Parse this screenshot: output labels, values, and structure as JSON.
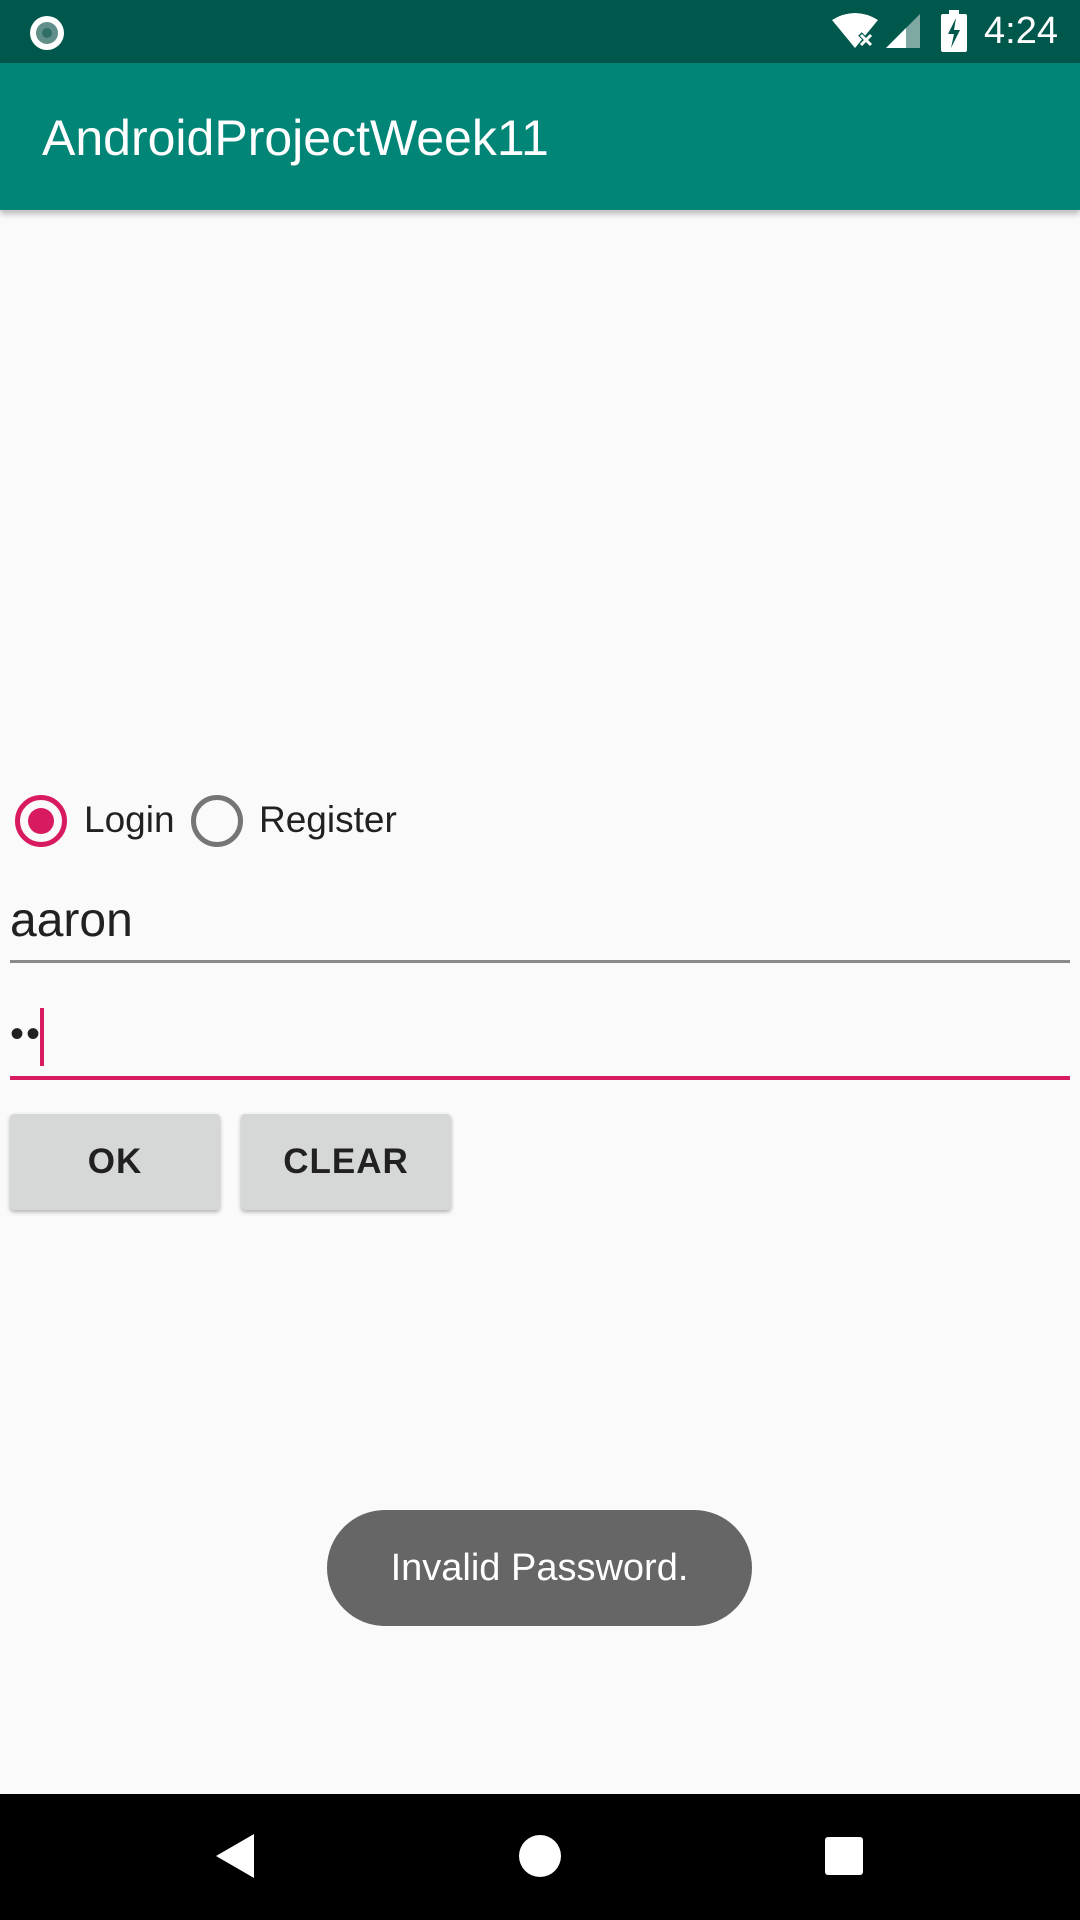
{
  "status_bar": {
    "time": "4:24",
    "icons": [
      "notification-dot-icon",
      "wifi-off-icon",
      "cell-signal-icon",
      "battery-charging-icon"
    ]
  },
  "app_bar": {
    "title": "AndroidProjectWeek11",
    "color": "#008577",
    "status_color": "#00574b"
  },
  "mode_selector": {
    "options": [
      {
        "label": "Login",
        "selected": true
      },
      {
        "label": "Register",
        "selected": false
      }
    ]
  },
  "form": {
    "username_value": "aaron",
    "password_value": "••"
  },
  "buttons": {
    "ok_label": "OK",
    "clear_label": "CLEAR"
  },
  "toast": {
    "message": "Invalid Password."
  },
  "nav_bar": {
    "icons": [
      "back-icon",
      "home-icon",
      "recents-icon"
    ]
  },
  "colors": {
    "accent": "#d81b60",
    "background": "#fafafa",
    "button": "#d6d7d7",
    "toast": "#666666"
  }
}
